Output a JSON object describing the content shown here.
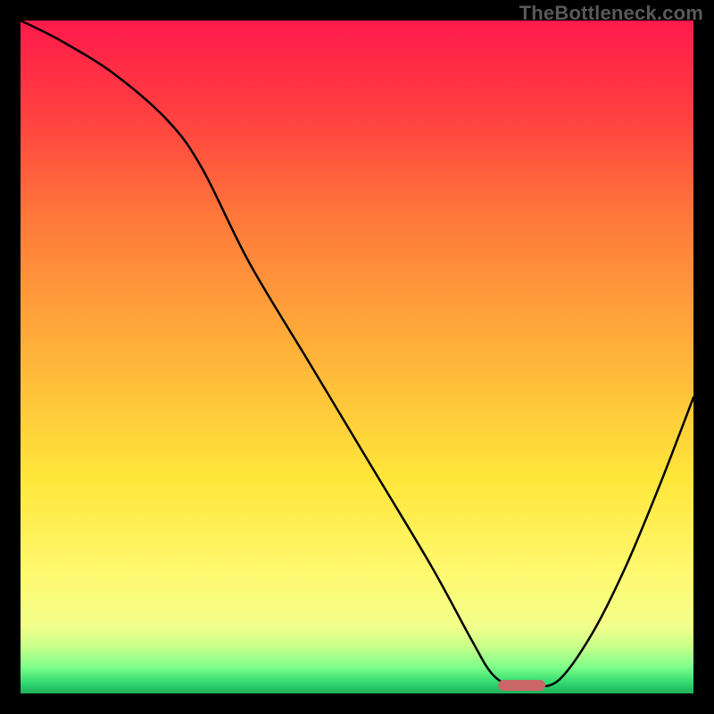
{
  "watermark": "TheBottleneck.com",
  "chart_data": {
    "type": "line",
    "title": "",
    "xlabel": "",
    "ylabel": "",
    "xlim": [
      0,
      100
    ],
    "ylim": [
      0,
      100
    ],
    "axes_visible": false,
    "grid": false,
    "background_gradient": {
      "orientation": "vertical",
      "stops": [
        {
          "offset": 0.0,
          "color": "#ff1a4b"
        },
        {
          "offset": 0.14,
          "color": "#ff4040"
        },
        {
          "offset": 0.3,
          "color": "#ff7a3a"
        },
        {
          "offset": 0.5,
          "color": "#ffb43a"
        },
        {
          "offset": 0.68,
          "color": "#ffe63a"
        },
        {
          "offset": 0.82,
          "color": "#fff970"
        },
        {
          "offset": 0.9,
          "color": "#f2ff8a"
        },
        {
          "offset": 0.93,
          "color": "#c8ff8a"
        },
        {
          "offset": 0.96,
          "color": "#7fff8a"
        },
        {
          "offset": 0.985,
          "color": "#2fd86f"
        },
        {
          "offset": 1.0,
          "color": "#1fae5a"
        }
      ]
    },
    "series": [
      {
        "name": "bottleneck-curve",
        "color": "#000000",
        "x": [
          0,
          6,
          14,
          22,
          27,
          34,
          43,
          52,
          61,
          67,
          70,
          73,
          76,
          80,
          85,
          90,
          95,
          100
        ],
        "y": [
          100,
          97,
          92,
          85,
          78,
          64,
          49,
          34,
          19,
          8,
          3,
          1,
          1,
          2,
          9,
          19,
          31,
          44
        ]
      }
    ],
    "marker": {
      "name": "optimal-range-marker",
      "color": "#cc6666",
      "x_start": 71,
      "x_end": 78,
      "y": 1.2,
      "thickness_pct": 1.6
    }
  }
}
